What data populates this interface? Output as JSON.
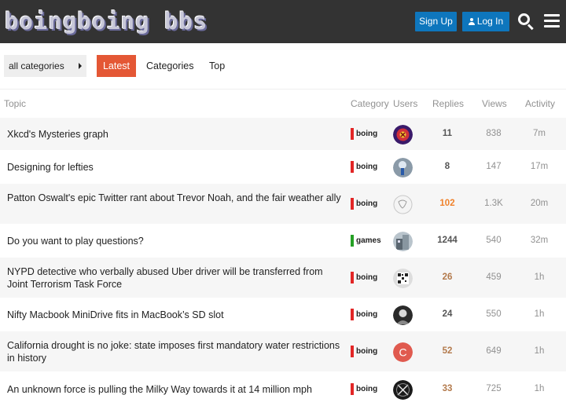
{
  "header": {
    "logo_text": "boingboing bbs",
    "signup_label": "Sign Up",
    "login_label": "Log In",
    "accent_color": "#0e76bd"
  },
  "nav": {
    "category_dropdown": "all categories",
    "tabs": [
      "Latest",
      "Categories",
      "Top"
    ],
    "active_tab": "Latest",
    "active_color": "#e45735"
  },
  "columns": {
    "topic": "Topic",
    "category": "Category",
    "users": "Users",
    "replies": "Replies",
    "views": "Views",
    "activity": "Activity"
  },
  "topics": [
    {
      "title": "Xkcd's Mysteries graph",
      "category": "boing",
      "category_color": "#e22626",
      "replies": "11",
      "views": "838",
      "activity": "7m",
      "reply_color": "#555555",
      "avatar_icon": "red-emblem-avatar"
    },
    {
      "title": "Designing for lefties",
      "category": "boing",
      "category_color": "#e22626",
      "replies": "8",
      "views": "147",
      "activity": "17m",
      "reply_color": "#555555",
      "avatar_icon": "blue-figure-avatar"
    },
    {
      "title": "Patton Oswalt's epic Twitter rant about Trevor Noah, and the fair weather ally",
      "category": "boing",
      "category_color": "#e22626",
      "replies": "102",
      "views": "1.3K",
      "activity": "20m",
      "reply_color": "#f0822c",
      "avatar_icon": "white-sketch-avatar"
    },
    {
      "title": "Do you want to play questions?",
      "category": "games",
      "category_color": "#25a025",
      "replies": "1244",
      "views": "540",
      "activity": "32m",
      "reply_color": "#555555",
      "avatar_icon": "building-avatar"
    },
    {
      "title": "NYPD detective who verbally abused Uber driver will be transferred from Joint Terrorism Task Force",
      "category": "boing",
      "category_color": "#e22626",
      "replies": "26",
      "views": "459",
      "activity": "1h",
      "reply_color": "#b37a4c",
      "avatar_icon": "qr-pattern-avatar"
    },
    {
      "title": "Nifty Macbook MiniDrive fits in MacBook’s SD slot",
      "category": "boing",
      "category_color": "#e22626",
      "replies": "24",
      "views": "550",
      "activity": "1h",
      "reply_color": "#555555",
      "avatar_icon": "portrait-avatar"
    },
    {
      "title": "California drought is no joke: state imposes first mandatory water restrictions in history",
      "category": "boing",
      "category_color": "#e22626",
      "replies": "52",
      "views": "649",
      "activity": "1h",
      "reply_color": "#b37a4c",
      "avatar_icon": "letter-c-avatar",
      "avatar_letter": "C"
    },
    {
      "title": "An unknown force is pulling the Milky Way towards it at 14 million mph",
      "category": "boing",
      "category_color": "#e22626",
      "replies": "33",
      "views": "725",
      "activity": "1h",
      "reply_color": "#b37a4c",
      "avatar_icon": "crossed-x-avatar"
    }
  ]
}
